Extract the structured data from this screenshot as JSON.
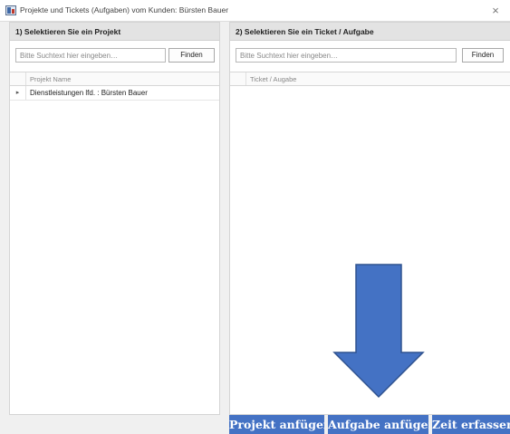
{
  "window": {
    "title": "Projekte und Tickets (Aufgaben) vom Kunden: Bürsten Bauer",
    "close_glyph": "×"
  },
  "left_panel": {
    "header": "1) Selektieren Sie ein Projekt",
    "search_placeholder": "Bitte Suchtext hier eingeben…",
    "find_label": "Finden",
    "column_label": "Projekt Name",
    "rows": [
      {
        "indicator": "▸",
        "name": "Dienstleistungen lfd. : Bürsten Bauer"
      }
    ]
  },
  "right_panel": {
    "header": "2) Selektieren Sie ein Ticket / Aufgabe",
    "search_placeholder": "Bitte Suchtext hier eingeben…",
    "find_label": "Finden",
    "column_label": "Ticket / Augabe"
  },
  "actions": {
    "projekt_label": "Projekt anfügen",
    "aufgabe_label": "Aufgabe anfügen",
    "zeit_label": "Zeit erfassen"
  },
  "colors": {
    "accent": "#4472c4",
    "arrow_fill": "#4472c4",
    "arrow_stroke": "#2f528f"
  }
}
